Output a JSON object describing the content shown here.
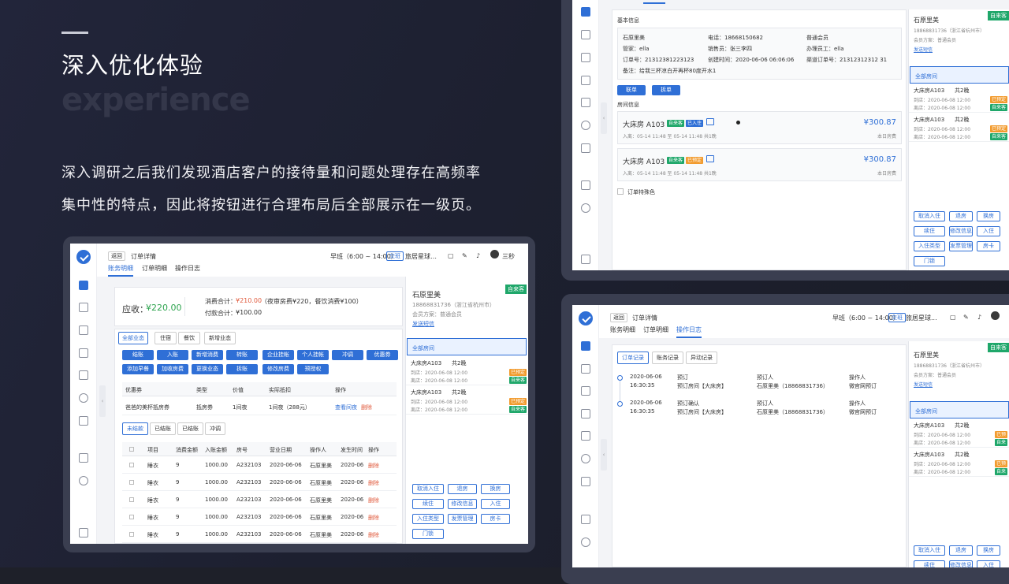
{
  "hero": {
    "headline": "深入优化体验",
    "ghost": "experience",
    "intro_line1": "深入调研之后我们发现酒店客户的接待量和问题处理存在高频率",
    "intro_line2": "集中性的特点，因此将按钮进行合理布局后全部展示在一级页。"
  },
  "main": {
    "back": "返回",
    "title": "订单详情",
    "shift": "早班（6:00 ~ 14:00）",
    "handover": "交班",
    "hotel": "旅居星球…",
    "user": "三秒",
    "tabs": [
      "账务明细",
      "订单明细",
      "操作日志"
    ],
    "receivable_label": "应收：",
    "receivable_value": "¥220.00",
    "consume_label": "消费合计：",
    "consume_value": "¥210.00",
    "consume_note": "（夜审房费¥220，餐饮消费¥100）",
    "paid_label": "付款合计：",
    "paid_value": "¥100.00",
    "biz_tabs": [
      "全部业态",
      "住宿",
      "餐饮",
      "新增业态"
    ],
    "actions_row1": [
      "结账",
      "入账",
      "新增消费",
      "转账",
      "企业挂帐",
      "个人挂帐",
      "冲调",
      "优惠券"
    ],
    "actions_row2": [
      "添加早餐",
      "加收房费",
      "更换业态",
      "拆账",
      "修改房费",
      "预授权"
    ],
    "coupon_head": [
      "优惠券",
      "类型",
      "价值",
      "实际抵扣",
      "操作"
    ],
    "coupon_row": [
      "爸爸的美杯抵房券",
      "抵房券",
      "1间夜",
      "1间夜（288元）",
      "查看间夜",
      "删除"
    ],
    "settle_tabs": [
      "未结款",
      "已结账",
      "已结账",
      "冲调"
    ],
    "table_head": [
      "项目",
      "消费金额",
      "入账金额",
      "房号",
      "营业日期",
      "操作人",
      "发生时间",
      "操作"
    ],
    "table_rows": [
      [
        "睡衣",
        "9",
        "1000.00",
        "A232103",
        "2020-06-06",
        "石原里美",
        "2020-06",
        "删除"
      ],
      [
        "睡衣",
        "9",
        "1000.00",
        "A232103",
        "2020-06-06",
        "石原里美",
        "2020-06",
        "删除"
      ],
      [
        "睡衣",
        "9",
        "1000.00",
        "A232103",
        "2020-06-06",
        "石原里美",
        "2020-06",
        "删除"
      ],
      [
        "睡衣",
        "9",
        "1000.00",
        "A232103",
        "2020-06-06",
        "石原里美",
        "2020-06",
        "删除"
      ],
      [
        "睡衣",
        "9",
        "1000.00",
        "A232103",
        "2020-06-06",
        "石原里美",
        "2020-06",
        "删除"
      ]
    ],
    "guest_name": "石原里美",
    "guest_phone": "18868831736（浙江省杭州市）",
    "member_plan": "会员方案：普通会员",
    "send_sms": "发送短信",
    "self_tag": "自来客",
    "all_rooms": "全部房间",
    "rooms": [
      {
        "name": "大床房A103",
        "nights": "共2晚",
        "arrive": "到店：2020-06-08 12:00",
        "leave": "离店：2020-06-08 12:00",
        "status": "已预定",
        "source": "自来客"
      },
      {
        "name": "大床房A103",
        "nights": "共2晚",
        "arrive": "到店：2020-06-08 12:00",
        "leave": "离店：2020-06-08 12:00",
        "status": "已预定",
        "source": "自来客"
      }
    ],
    "side_buttons": [
      "取消入住",
      "退房",
      "换房",
      "续住",
      "修改信息",
      "入住",
      "入住类型",
      "发票管理",
      "房卡",
      "门锁"
    ]
  },
  "topright": {
    "basic_info": "基本信息",
    "info": {
      "name": "石原里美",
      "phone": "电话：18668150682",
      "level": "普通会员",
      "keeper": "管家：ella",
      "sales": "销售员：张三李四",
      "handler": "办理员工：ella",
      "order_no": "订单号：21312381223123",
      "created": "创建时间：2020-06-06 06:06:06",
      "channel_no": "渠道订单号：21312312312 31",
      "remark": "备注：给我三杯凉白开再杯80度开水1"
    },
    "link_btn": "联单",
    "split_btn": "拆单",
    "room_info": "房间信息",
    "room_cards": [
      {
        "name": "大床房 A103",
        "tags": [
          "自来客",
          "已入住"
        ],
        "stay": "入离：05-14 11:48 至 05-14 11:48 共1晚",
        "price": "¥300.87",
        "price_note": "本日房费"
      },
      {
        "name": "大床房 A103",
        "tags": [
          "自来客",
          "已预定"
        ],
        "stay": "入离：05-14 11:48 至 05-14 11:48 共1晚",
        "price": "¥300.87",
        "price_note": "本日房费"
      }
    ],
    "special_color": "订单特殊色",
    "guest_name": "石原里美",
    "guest_phone": "18868831736（浙江省杭州市）",
    "member_plan": "会员方案：普通会员",
    "send_sms": "发送短信",
    "self_tag": "自来客",
    "all_rooms": "全部房间",
    "rooms": [
      {
        "name": "大床房A103",
        "nights": "共2晚",
        "arrive": "到店：2020-06-08 12:00",
        "leave": "离店：2020-06-08 12:00",
        "status": "已预定",
        "source": "自来客"
      },
      {
        "name": "大床房A103",
        "nights": "共2晚",
        "arrive": "到店：2020-06-08 12:00",
        "leave": "离店：2020-06-08 12:00",
        "status": "已预定",
        "source": "自来客"
      }
    ],
    "side_buttons": [
      "取消入住",
      "退房",
      "换房",
      "续住",
      "修改信息",
      "入住",
      "入住类型",
      "发票管理",
      "房卡",
      "门锁"
    ]
  },
  "bottomright": {
    "back": "返回",
    "title": "订单详情",
    "shift": "早班（6:00 ~ 14:00）",
    "handover": "交班",
    "hotel": "旅居星球...",
    "tabs": [
      "账务明细",
      "订单明细",
      "操作日志"
    ],
    "log_tabs": [
      "订单记录",
      "账务记录",
      "异动记录"
    ],
    "logs": [
      {
        "date": "2020-06-06",
        "time": "16:30:35",
        "action": "预订",
        "detail": "预订房间【大床房】",
        "who_label": "预订人",
        "who": "石原里美（18868831736）",
        "op_label": "操作人",
        "op": "微官网预订"
      },
      {
        "date": "2020-06-06",
        "time": "16:30:35",
        "action": "预订确认",
        "detail": "预订房间【大床房】",
        "who_label": "预订人",
        "who": "石原里美（18868831736）",
        "op_label": "操作人",
        "op": "微官网预订"
      }
    ],
    "guest_name": "石原里美",
    "guest_phone": "18868831736（浙江省杭州市）",
    "member_plan": "会员方案：普通会员",
    "send_sms": "发送短信",
    "self_tag": "自来客",
    "all_rooms": "全部房间",
    "rooms": [
      {
        "name": "大床房A103",
        "nights": "共2晚",
        "arrive": "到店：2020-06-08 12:00",
        "leave": "离店：2020-06-08 12:00",
        "status": "已预",
        "source": "自来"
      },
      {
        "name": "大床房A103",
        "nights": "共2晚",
        "arrive": "到店：2020-06-08 12:00",
        "leave": "离店：2020-06-08 12:00",
        "status": "已预",
        "source": "自来"
      }
    ],
    "side_buttons": [
      "取消入住",
      "退房",
      "换房",
      "续住",
      "修改信息",
      "入住"
    ]
  }
}
